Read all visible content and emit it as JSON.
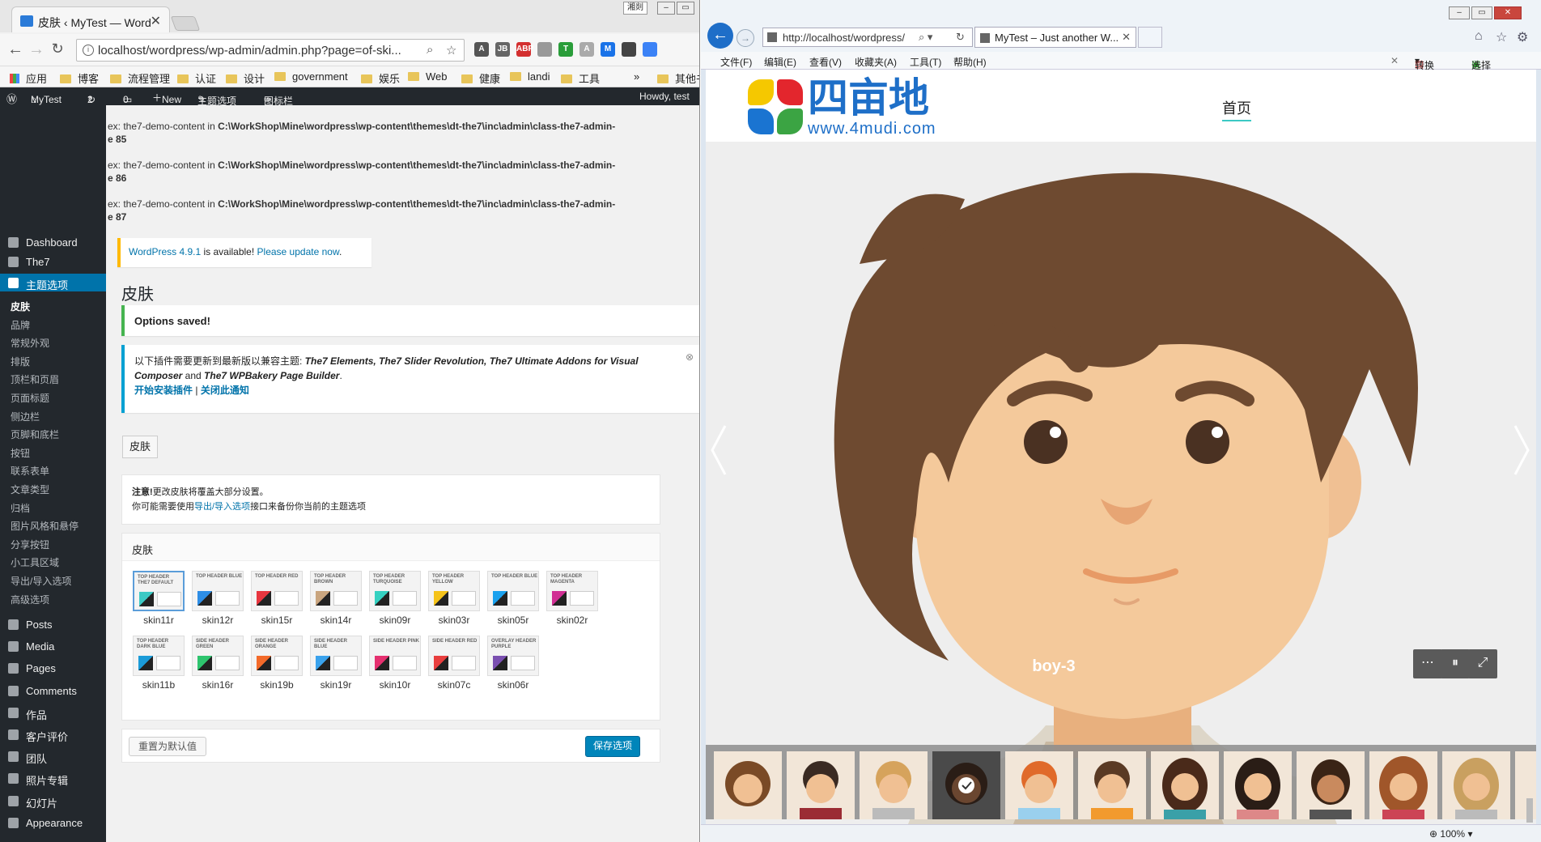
{
  "chrome": {
    "tab_title": "皮肤 ‹ MyTest — Word",
    "window_label": "湘剡",
    "url": "localhost/wordpress/wp-admin/admin.php?page=of-ski...",
    "bookmarks": [
      "应用",
      "博客",
      "流程管理",
      "认证",
      "设计",
      "government",
      "娱乐",
      "Web",
      "健康",
      "landi",
      "工具",
      "其他书"
    ],
    "extensions": [
      {
        "name": "angular-icon",
        "color": "#555",
        "label": "A"
      },
      {
        "name": "jb-icon",
        "color": "#666",
        "label": "JB"
      },
      {
        "name": "adblock-icon",
        "color": "#d32f2f",
        "label": "ABP"
      },
      {
        "name": "grey-ext-icon",
        "color": "#999",
        "label": ""
      },
      {
        "name": "shield-ext-icon",
        "color": "#2a9d3a",
        "label": "T"
      },
      {
        "name": "grey-a-icon",
        "color": "#aaa",
        "label": "A"
      },
      {
        "name": "m-icon",
        "color": "#1a73e8",
        "label": "M"
      },
      {
        "name": "pocket-icon",
        "color": "#444",
        "label": ""
      },
      {
        "name": "blue-shield-icon",
        "color": "#3b82f6",
        "label": ""
      }
    ]
  },
  "wp": {
    "adminbar": {
      "site": "MyTest",
      "updates": "2",
      "comments": "0",
      "new": "New",
      "theme_options": "主题选项",
      "icon_bar": "图标栏",
      "howdy": "Howdy, test"
    },
    "notices": [
      {
        "prefix": "ex: the7-demo-content in ",
        "path": "C:\\WorkShop\\Mine\\wordpress\\wp-content\\themes\\dt-the7\\inc\\admin\\class-the7-admin-",
        "line": "e 85"
      },
      {
        "prefix": "ex: the7-demo-content in ",
        "path": "C:\\WorkShop\\Mine\\wordpress\\wp-content\\themes\\dt-the7\\inc\\admin\\class-the7-admin-",
        "line": "e 86"
      },
      {
        "prefix": "ex: the7-demo-content in ",
        "path": "C:\\WorkShop\\Mine\\wordpress\\wp-content\\themes\\dt-the7\\inc\\admin\\class-the7-admin-",
        "line": "e 87"
      }
    ],
    "update": {
      "link": "WordPress 4.9.1",
      "mid": " is available! ",
      "link2": "Please update now",
      "end": "."
    },
    "page_title": "皮肤",
    "saved": "Options saved!",
    "plugin_notice": {
      "lead": "以下插件需要更新到最新版以兼容主题: ",
      "plugins": "The7 Elements, The7 Slider Revolution, The7 Ultimate Addons for Visual Composer",
      "and": " and ",
      "last": "The7 WPBakery Page Builder",
      "end": ".",
      "install": "开始安装插件",
      "sep": " | ",
      "dismiss": "关闭此通知"
    },
    "tab_button": "皮肤",
    "warning": {
      "bold": "注意!",
      "line1": "更改皮肤将覆盖大部分设置。",
      "line2a": "你可能需要使用",
      "link": "导出/导入选项",
      "line2b": "接口来备份你当前的主题选项"
    },
    "skins_heading": "皮肤",
    "skins": [
      {
        "title": "top header the7 default",
        "name": "skin11r",
        "color": "#3cc9c4",
        "selected": true
      },
      {
        "title": "top header blue",
        "name": "skin12r",
        "color": "#2e8ee6",
        "selected": false
      },
      {
        "title": "top header red",
        "name": "skin15r",
        "color": "#e8363f",
        "selected": false
      },
      {
        "title": "top header brown",
        "name": "skin14r",
        "color": "#c9a57f",
        "selected": false
      },
      {
        "title": "top header turquoise",
        "name": "skin09r",
        "color": "#35d1c1",
        "selected": false
      },
      {
        "title": "top header yellow",
        "name": "skin03r",
        "color": "#f5c31a",
        "selected": false
      },
      {
        "title": "top header blue",
        "name": "skin05r",
        "color": "#1aa1ee",
        "selected": false
      },
      {
        "title": "top header magenta",
        "name": "skin02r",
        "color": "#d12f94",
        "selected": false
      },
      {
        "title": "top header dark blue",
        "name": "skin11b",
        "color": "#1b9bd8",
        "selected": false
      },
      {
        "title": "side header green",
        "name": "skin16r",
        "color": "#2ec46e",
        "selected": false
      },
      {
        "title": "side header orange",
        "name": "skin19b",
        "color": "#f36a2a",
        "selected": false
      },
      {
        "title": "side header blue",
        "name": "skin19r",
        "color": "#3aa2ec",
        "selected": false
      },
      {
        "title": "side header pink",
        "name": "skin10r",
        "color": "#e5306f",
        "selected": false
      },
      {
        "title": "side header red",
        "name": "skin07c",
        "color": "#e83e3e",
        "selected": false
      },
      {
        "title": "overlay header purple",
        "name": "skin06r",
        "color": "#7a4fb0",
        "selected": false
      }
    ],
    "reset": "重置为默认值",
    "save": "保存选项",
    "menu_top": [
      {
        "label": "Dashboard",
        "icon": "dashboard-icon"
      },
      {
        "label": "The7",
        "icon": "gear-icon"
      },
      {
        "label": "主题选项",
        "icon": "gear-icon",
        "active": true
      }
    ],
    "submenu": [
      "皮肤",
      "品牌",
      "常规外观",
      "排版",
      "顶栏和页眉",
      "页面标题",
      "侧边栏",
      "页脚和底栏",
      "按钮",
      "联系表单",
      "文章类型",
      "归档",
      "图片风格和悬停",
      "分享按钮",
      "小工具区域",
      "导出/导入选项",
      "高级选项"
    ],
    "menu_bottom": [
      {
        "label": "Posts",
        "icon": "pin-icon"
      },
      {
        "label": "Media",
        "icon": "media-icon"
      },
      {
        "label": "Pages",
        "icon": "page-icon"
      },
      {
        "label": "Comments",
        "icon": "comment-icon"
      },
      {
        "label": "作品",
        "icon": "portfolio-icon"
      },
      {
        "label": "客户评价",
        "icon": "thumbs-icon"
      },
      {
        "label": "团队",
        "icon": "team-icon"
      },
      {
        "label": "照片专辑",
        "icon": "album-icon"
      },
      {
        "label": "幻灯片",
        "icon": "slides-icon"
      },
      {
        "label": "Appearance",
        "icon": "brush-icon"
      }
    ]
  },
  "ie": {
    "address": "http://localhost/wordpress/",
    "tab": "MyTest – Just another W...",
    "menu": [
      "文件(F)",
      "编辑(E)",
      "查看(V)",
      "收藏夹(A)",
      "工具(T)",
      "帮助(H)"
    ],
    "convert": "转换",
    "select": "选择",
    "zoom": "100%",
    "site": {
      "logo_cn": "四亩地",
      "logo_url": "www.4mudi.com",
      "nav_home": "首页"
    },
    "slide_caption": "boy-3"
  }
}
